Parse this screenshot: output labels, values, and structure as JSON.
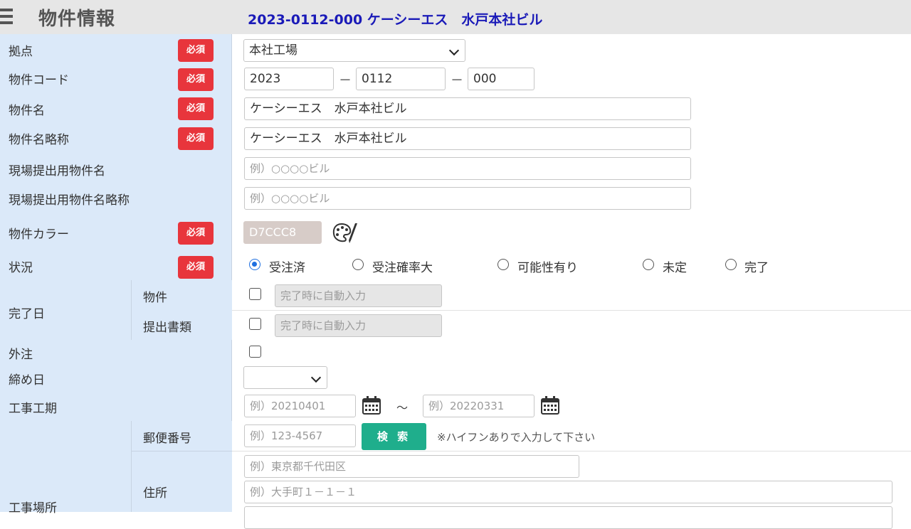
{
  "header": {
    "title": "物件情報",
    "property_heading": "2023-0112-000 ケーシーエス　水戸本社ビル"
  },
  "required_badge": "必須",
  "fields": {
    "base": {
      "label": "拠点",
      "value": "本社工場"
    },
    "code": {
      "label": "物件コード",
      "part1": "2023",
      "part2": "0112",
      "part3": "000",
      "separator": "－"
    },
    "name": {
      "label": "物件名",
      "value": "ケーシーエス　水戸本社ビル"
    },
    "short_name": {
      "label": "物件名略称",
      "value": "ケーシーエス　水戸本社ビル"
    },
    "site_name": {
      "label": "現場提出用物件名",
      "placeholder": "例）○○○○ビル"
    },
    "site_short_name": {
      "label": "現場提出用物件名略称",
      "placeholder": "例）○○○○ビル"
    },
    "color": {
      "label": "物件カラー",
      "value": "D7CCC8"
    },
    "status": {
      "label": "状況",
      "selected": "受注済",
      "options": [
        "受注済",
        "受注確率大",
        "可能性有り",
        "未定",
        "完了"
      ]
    },
    "completion": {
      "label": "完了日",
      "property_label": "物件",
      "documents_label": "提出書類",
      "auto_placeholder": "完了時に自動入力"
    },
    "outsourcing": {
      "label": "外注"
    },
    "closing_day": {
      "label": "締め日",
      "value": ""
    },
    "period": {
      "label": "工事工期",
      "start_placeholder": "例）20210401",
      "end_placeholder": "例）20220331",
      "tilde": "～"
    },
    "location": {
      "label": "工事場所",
      "postal_label": "郵便番号",
      "postal_placeholder": "例）123-4567",
      "search_button": "検 索",
      "postal_hint": "※ハイフンありで入力して下さい",
      "address_label": "住所",
      "address1_placeholder": "例）東京都千代田区",
      "address2_placeholder": "例）大手町１－１－１"
    }
  },
  "colors": {
    "required": "#e8353c",
    "label_bg": "#dbe9f9",
    "heading": "#1a1ab8",
    "search_btn": "#1fae8c",
    "swatch": "#D7CCC8"
  },
  "icons": [
    "menu-icon",
    "chevron-down-icon",
    "palette-icon",
    "calendar-icon"
  ]
}
